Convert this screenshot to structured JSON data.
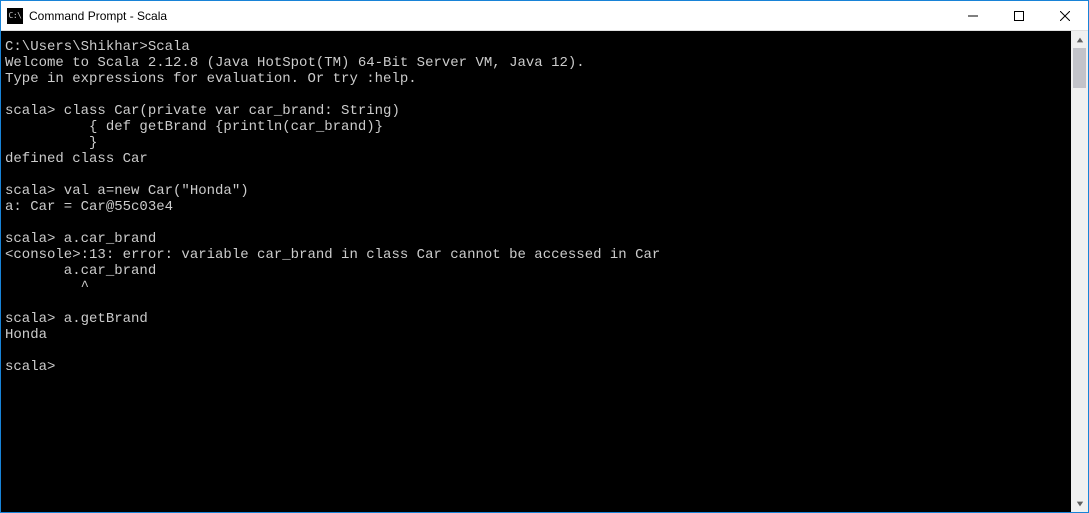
{
  "titlebar": {
    "icon_label": "C:\\",
    "title": "Command Prompt - Scala"
  },
  "terminal": {
    "lines": [
      "C:\\Users\\Shikhar>Scala",
      "Welcome to Scala 2.12.8 (Java HotSpot(TM) 64-Bit Server VM, Java 12).",
      "Type in expressions for evaluation. Or try :help.",
      "",
      "scala> class Car(private var car_brand: String)",
      "          { def getBrand {println(car_brand)}",
      "          }",
      "defined class Car",
      "",
      "scala> val a=new Car(\"Honda\")",
      "a: Car = Car@55c03e4",
      "",
      "scala> a.car_brand",
      "<console>:13: error: variable car_brand in class Car cannot be accessed in Car",
      "       a.car_brand",
      "         ^",
      "",
      "scala> a.getBrand",
      "Honda",
      "",
      "scala>"
    ]
  }
}
